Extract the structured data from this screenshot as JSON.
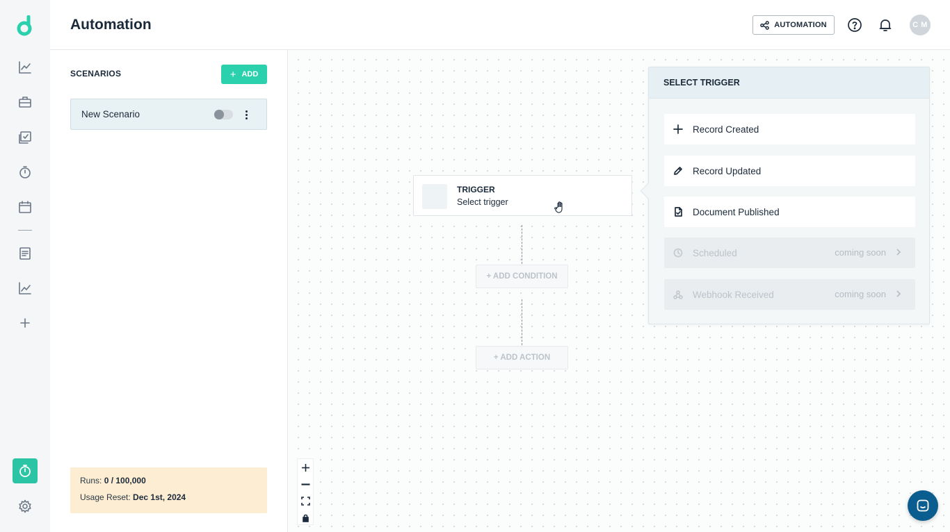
{
  "header": {
    "title": "Automation",
    "automation_button": "AUTOMATION",
    "avatar_initials": "C M"
  },
  "sidebar": {
    "items": [
      {
        "icon": "chart-line-icon"
      },
      {
        "icon": "briefcase-icon"
      },
      {
        "icon": "tasks-checklist-icon"
      },
      {
        "icon": "stopwatch-icon"
      },
      {
        "icon": "calendar-icon"
      },
      {
        "icon": "document-icon"
      },
      {
        "icon": "analytics-icon"
      },
      {
        "icon": "plus-icon"
      }
    ],
    "active_item": "stopwatch-icon",
    "bottom": "gear-icon"
  },
  "scenarios": {
    "title": "SCENARIOS",
    "add_label": "ADD",
    "items": [
      {
        "name": "New Scenario",
        "enabled": false
      }
    ],
    "usage": {
      "runs_label": "Runs:",
      "runs_value": "0 / 100,000",
      "reset_label": "Usage Reset:",
      "reset_value": "Dec 1st, 2024"
    }
  },
  "canvas": {
    "trigger_node": {
      "title": "TRIGGER",
      "subtitle": "Select trigger"
    },
    "add_condition": "+ ADD CONDITION",
    "add_action": "+ ADD ACTION"
  },
  "select_trigger": {
    "title": "SELECT TRIGGER",
    "options": [
      {
        "label": "Record Created",
        "icon": "plus-icon",
        "available": true
      },
      {
        "label": "Record Updated",
        "icon": "pencil-icon",
        "available": true
      },
      {
        "label": "Document Published",
        "icon": "document-check-icon",
        "available": true
      },
      {
        "label": "Scheduled",
        "icon": "clock-icon",
        "available": false,
        "badge": "coming soon"
      },
      {
        "label": "Webhook Received",
        "icon": "webhook-icon",
        "available": false,
        "badge": "coming soon"
      }
    ]
  },
  "colors": {
    "accent": "#2bd1ad",
    "usage_bg": "#fdeed3",
    "chat": "#0a5d8f"
  }
}
